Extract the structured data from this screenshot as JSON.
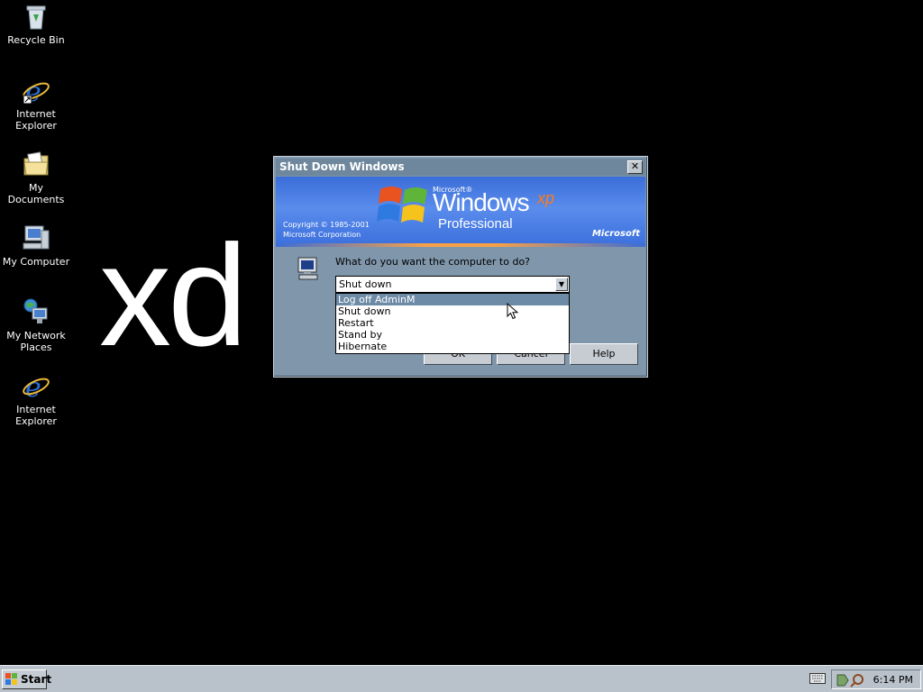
{
  "desktop": {
    "icons": [
      {
        "label": "Recycle Bin",
        "icon": "recycle-bin-icon"
      },
      {
        "label": "Internet\nExplorer",
        "icon": "internet-explorer-icon"
      },
      {
        "label": "My Documents",
        "icon": "my-documents-icon"
      },
      {
        "label": "My Computer",
        "icon": "my-computer-icon"
      },
      {
        "label": "My Network\nPlaces",
        "icon": "my-network-places-icon"
      },
      {
        "label": "Internet\nExplorer",
        "icon": "internet-explorer-icon"
      }
    ],
    "big_text": "xd"
  },
  "dialog": {
    "title": "Shut Down Windows",
    "close": "✕",
    "banner": {
      "microsoft_small": "Microsoft®",
      "windows": "Windows",
      "xp": "xp",
      "edition": "Professional",
      "copyright_line1": "Copyright © 1985-2001",
      "copyright_line2": "Microsoft Corporation",
      "brand": "Microsoft"
    },
    "question": "What do you want the computer to do?",
    "selected": "Shut down",
    "options": [
      "Log off AdminM",
      "Shut down",
      "Restart",
      "Stand by",
      "Hibernate"
    ],
    "highlighted_option": "Log off AdminM",
    "buttons": {
      "ok": "OK",
      "cancel": "Cancel",
      "help": "Help"
    }
  },
  "taskbar": {
    "start_label": "Start",
    "clock": "6:14 PM"
  },
  "colors": {
    "desktop": "#000000",
    "dialog_body": "#7f96ab",
    "titlebar": "#6e879d",
    "highlight": "#6d8ba6",
    "taskbar": "#b9c2cb"
  }
}
